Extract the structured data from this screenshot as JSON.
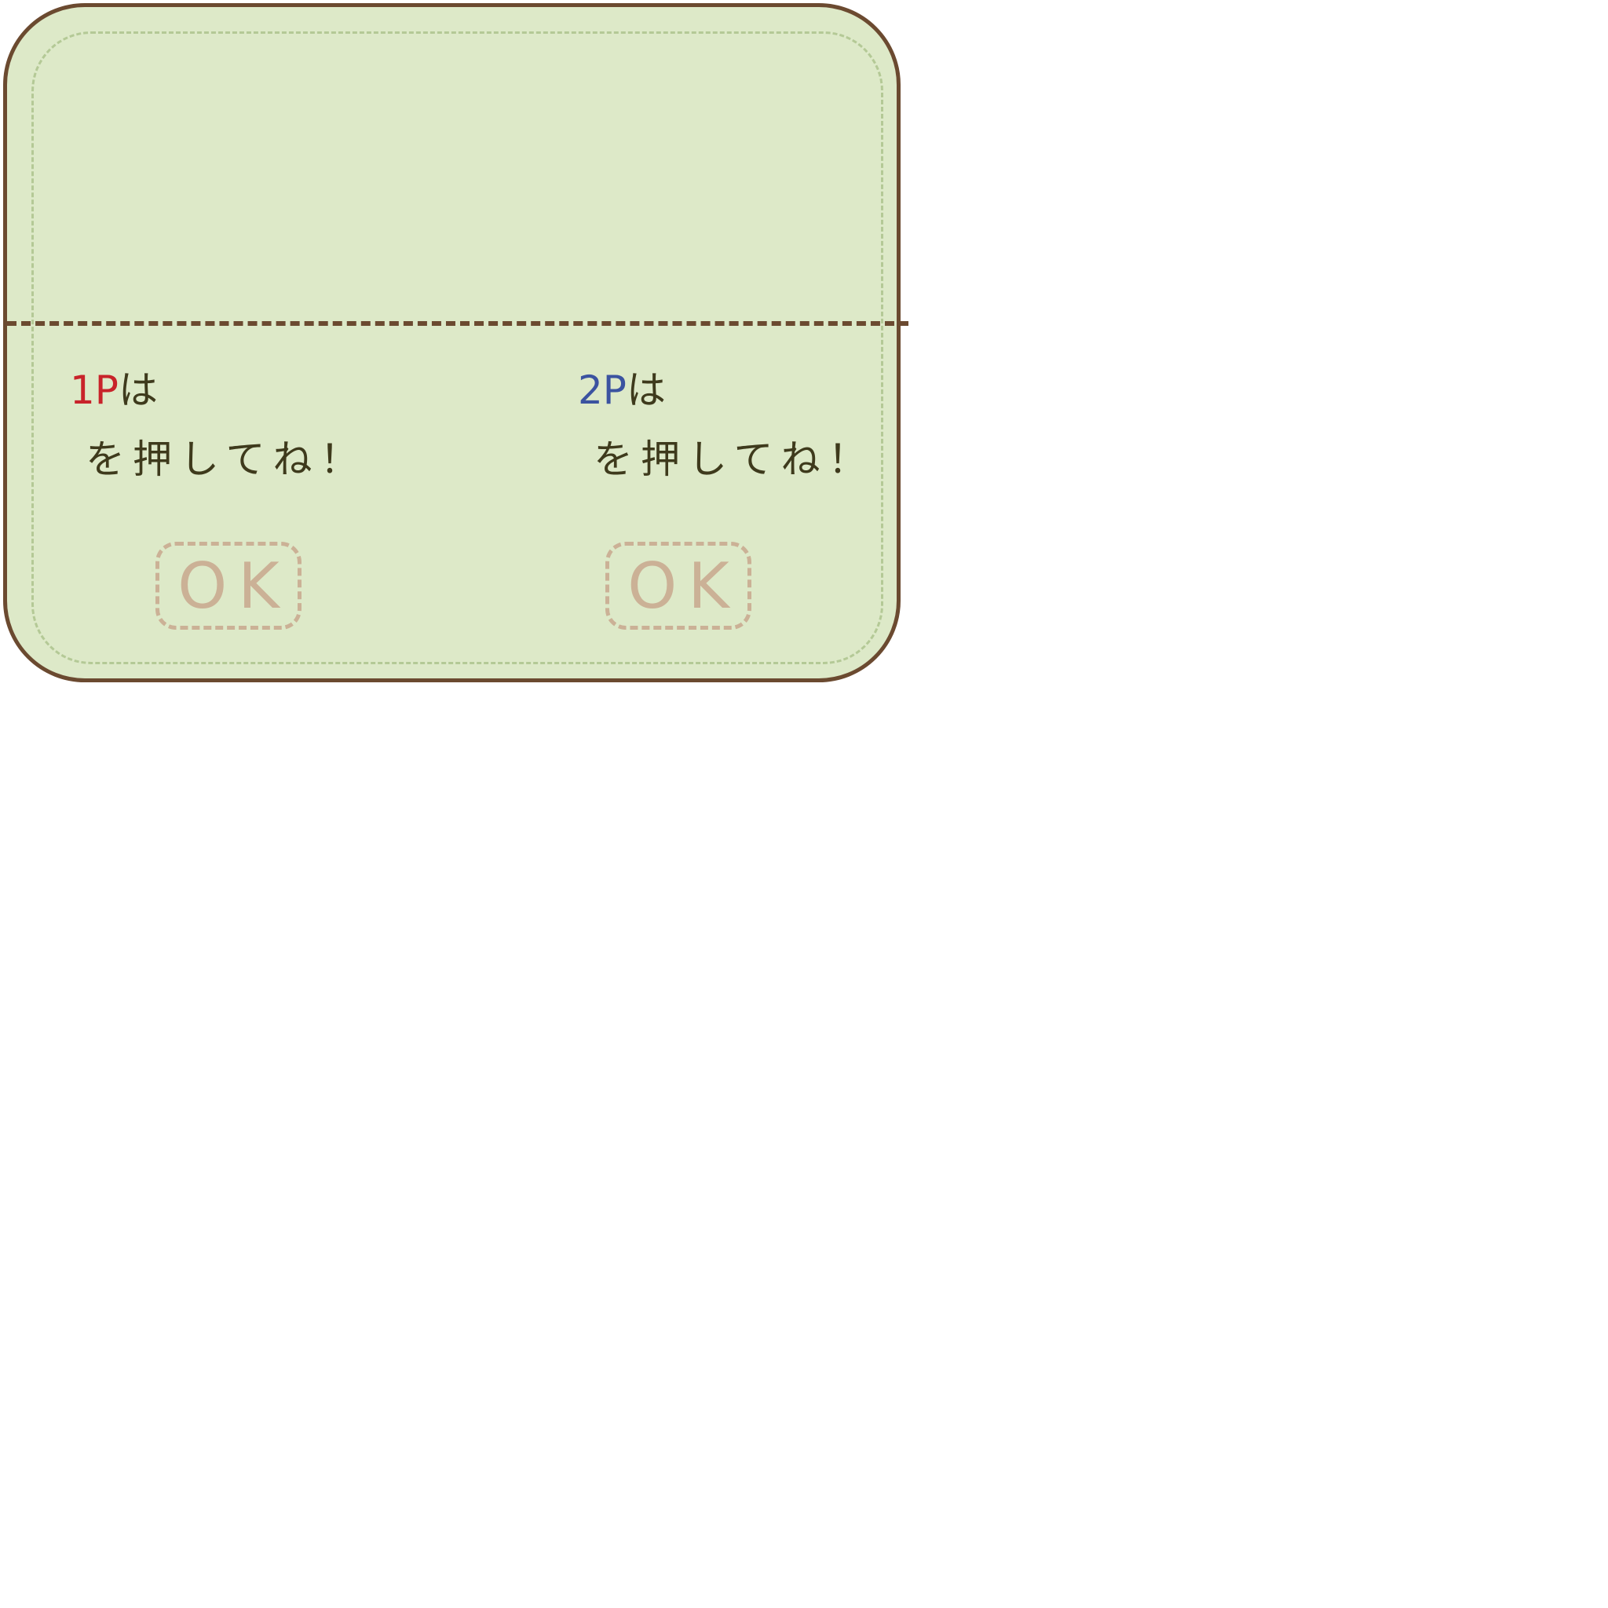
{
  "player1": {
    "tag": "1P",
    "particle": "は",
    "instruction": "を押してね！"
  },
  "player2": {
    "tag": "2P",
    "particle": "は",
    "instruction": "を押してね！"
  },
  "ok_button_label": "OK",
  "colors": {
    "panel_bg": "#dde9c8",
    "panel_border": "#6b4a30",
    "stitch": "#b4c996",
    "player1_tag": "#c8232a",
    "player2_tag": "#3b53a0",
    "text": "#3e3a1c",
    "ok_button": "#cbb196"
  }
}
